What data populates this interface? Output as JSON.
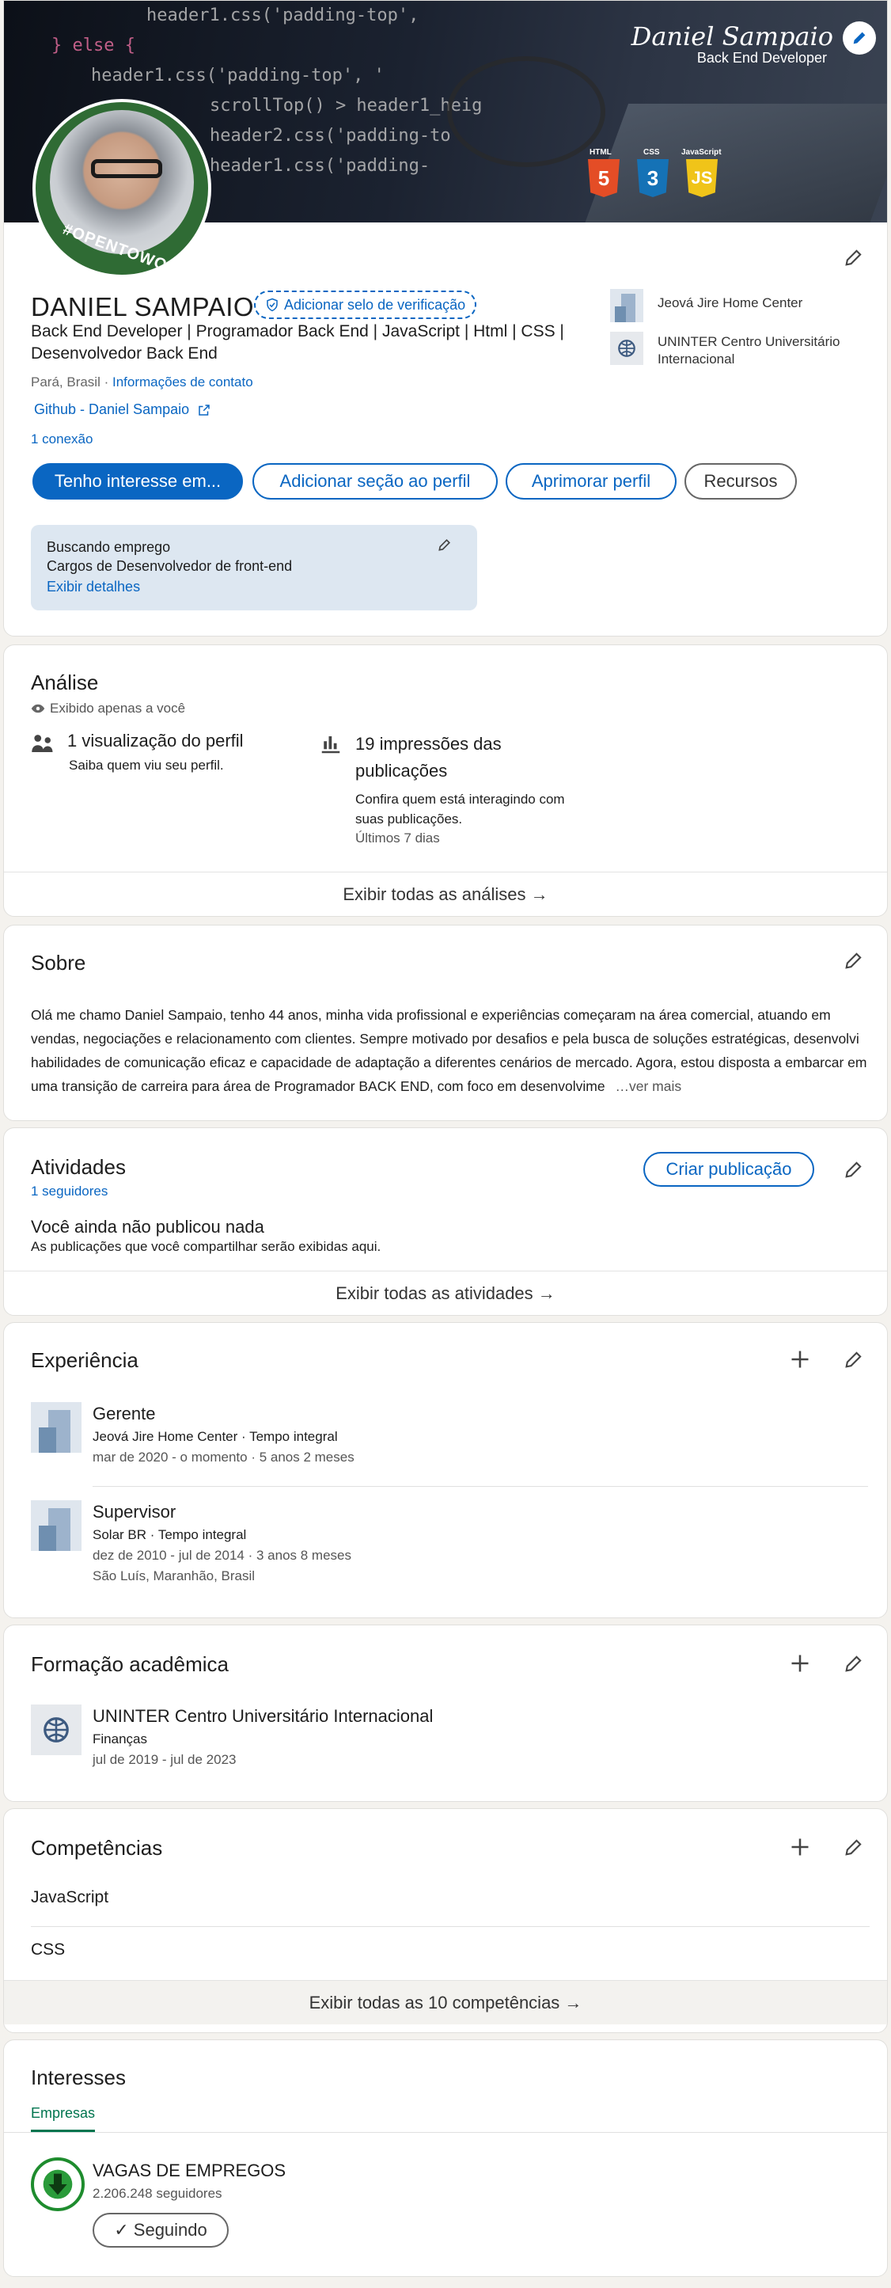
{
  "banner": {
    "name": "Daniel Sampaio",
    "role": "Back End Developer",
    "code_lines": [
      "header1.css('padding-top',",
      "} else {",
      "header1.css('padding-top', '",
      "scrollTop() > header1_heig",
      "header2.css('padding-to",
      "header1.css('padding-"
    ],
    "badges": [
      "HTML",
      "CSS",
      "JavaScript"
    ]
  },
  "profile": {
    "avatar_ring_text": "#OPENTOWORK",
    "name": "DANIEL SAMPAIO",
    "verify_label": "Adicionar selo de verificação",
    "headline": "Back End Developer | Programador Back End | JavaScript | Html | CSS | Desenvolvedor Back End",
    "location": "Pará, Brasil ·",
    "contact_label": "Informações de contato",
    "github_label": "Github - Daniel Sampaio",
    "connections": "1 conexão",
    "companies": [
      {
        "name": "Jeová Jire Home Center"
      },
      {
        "name": "UNINTER Centro Universitário Internacional"
      }
    ],
    "buttons": {
      "interest": "Tenho interesse em...",
      "add_section": "Adicionar seção ao perfil",
      "improve": "Aprimorar perfil",
      "resources": "Recursos"
    },
    "job_box": {
      "line1": "Buscando emprego",
      "line2": "Cargos de Desenvolvedor de front-end",
      "link": "Exibir detalhes"
    }
  },
  "analytics": {
    "title": "Análise",
    "private_note": "Exibido apenas a você",
    "views": {
      "title": "1 visualização do perfil",
      "desc": "Saiba quem viu seu perfil."
    },
    "impressions": {
      "title": "19 impressões das publicações",
      "desc": "Confira quem está interagindo com suas publicações.",
      "period": "Últimos 7 dias"
    },
    "footer": "Exibir todas as análises →"
  },
  "about": {
    "title": "Sobre",
    "text": "Olá me chamo Daniel Sampaio, tenho 44 anos, minha vida profissional e experiências começaram na área comercial, atuando em vendas, negociações e relacionamento com clientes. Sempre motivado por desafios e pela busca de soluções estratégicas, desenvolvi habilidades de comunicação eficaz e capacidade de adaptação a diferentes cenários de mercado. Agora, estou disposta a embarcar em uma transição de carreira para área de Programador BACK END, com foco em desenvolvime",
    "more": "…ver mais"
  },
  "activities": {
    "title": "Atividades",
    "followers": "1 seguidores",
    "create_post": "Criar publicação",
    "empty_title": "Você ainda não publicou nada",
    "empty_desc": "As publicações que você compartilhar serão exibidas aqui.",
    "footer": "Exibir todas as atividades →"
  },
  "experience": {
    "title": "Experiência",
    "items": [
      {
        "role": "Gerente",
        "company": "Jeová Jire Home Center · Tempo integral",
        "dates": "mar de 2020 - o momento · 5 anos 2 meses",
        "location": ""
      },
      {
        "role": "Supervisor",
        "company": "Solar BR · Tempo integral",
        "dates": "dez de 2010 - jul de 2014 · 3 anos 8 meses",
        "location": "São Luís, Maranhão, Brasil"
      }
    ]
  },
  "education": {
    "title": "Formação acadêmica",
    "items": [
      {
        "school": "UNINTER Centro Universitário Internacional",
        "field": "Finanças",
        "dates": "jul de 2019 - jul de 2023"
      }
    ]
  },
  "skills": {
    "title": "Competências",
    "items": [
      "JavaScript",
      "CSS"
    ],
    "footer": "Exibir todas as 10 competências →"
  },
  "interests": {
    "title": "Interesses",
    "tab": "Empresas",
    "items": [
      {
        "name": "VAGAS DE EMPREGOS",
        "followers": "2.206.248 seguidores",
        "button": "✓ Seguindo"
      }
    ]
  }
}
